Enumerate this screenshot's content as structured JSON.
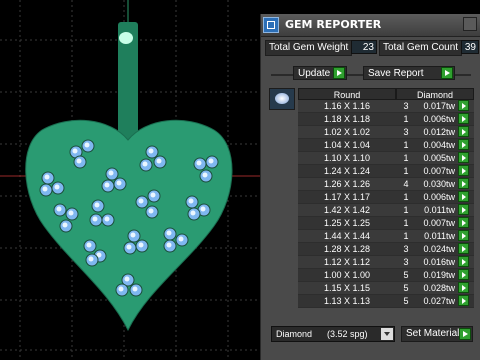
{
  "panel": {
    "title": "GEM REPORTER",
    "total_gem_weight_label": "Total Gem Weight",
    "total_gem_weight_value": "23",
    "total_gem_count_label": "Total Gem Count",
    "total_gem_count_value": "39",
    "update_label": "Update",
    "save_report_label": "Save Report",
    "table_headers": [
      "Round",
      "Diamond"
    ],
    "rows": [
      {
        "size": "1.16 X 1.16",
        "count": "3",
        "weight": "0.017tw"
      },
      {
        "size": "1.18 X 1.18",
        "count": "1",
        "weight": "0.006tw"
      },
      {
        "size": "1.02 X 1.02",
        "count": "3",
        "weight": "0.012tw"
      },
      {
        "size": "1.04 X 1.04",
        "count": "1",
        "weight": "0.004tw"
      },
      {
        "size": "1.10 X 1.10",
        "count": "1",
        "weight": "0.005tw"
      },
      {
        "size": "1.24 X 1.24",
        "count": "1",
        "weight": "0.007tw"
      },
      {
        "size": "1.26 X 1.26",
        "count": "4",
        "weight": "0.030tw"
      },
      {
        "size": "1.17 X 1.17",
        "count": "1",
        "weight": "0.006tw"
      },
      {
        "size": "1.42 X 1.42",
        "count": "1",
        "weight": "0.011tw"
      },
      {
        "size": "1.25 X 1.25",
        "count": "1",
        "weight": "0.007tw"
      },
      {
        "size": "1.44 X 1.44",
        "count": "1",
        "weight": "0.011tw"
      },
      {
        "size": "1.28 X 1.28",
        "count": "3",
        "weight": "0.024tw"
      },
      {
        "size": "1.12 X 1.12",
        "count": "3",
        "weight": "0.016tw"
      },
      {
        "size": "1.00 X 1.00",
        "count": "5",
        "weight": "0.019tw"
      },
      {
        "size": "1.15 X 1.15",
        "count": "5",
        "weight": "0.028tw"
      },
      {
        "size": "1.13 X 1.13",
        "count": "5",
        "weight": "0.027tw"
      }
    ],
    "material_select_value": "Diamond      (3.52 spg)",
    "set_material_label": "Set Material"
  },
  "colors": {
    "pendant": "#2a9b72",
    "gem": "#7fb7f0",
    "go_button": "#2fa02f"
  }
}
